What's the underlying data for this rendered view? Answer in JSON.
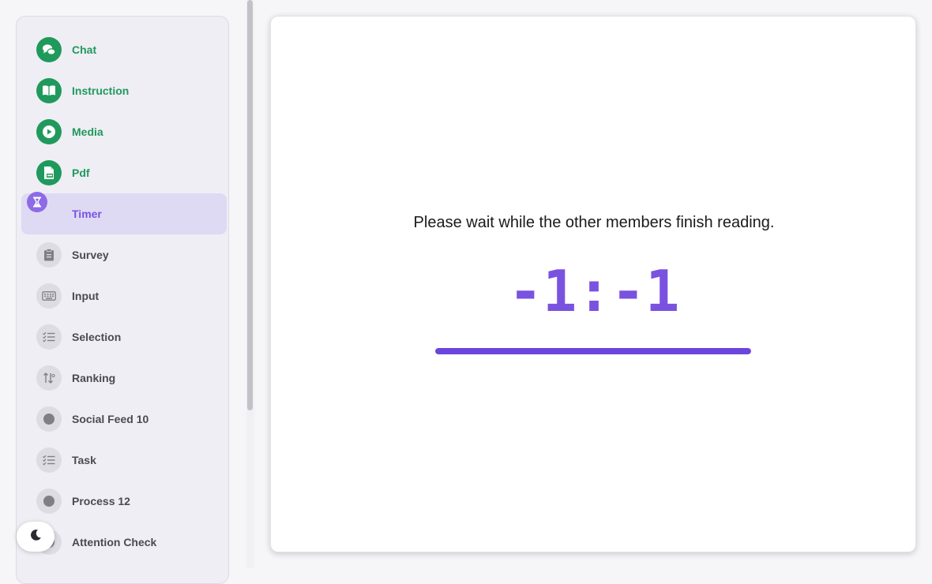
{
  "sidebar": {
    "items": [
      {
        "label": "Chat",
        "icon": "chat-bubbles-icon",
        "state": "done"
      },
      {
        "label": "Instruction",
        "icon": "book-open-icon",
        "state": "done"
      },
      {
        "label": "Media",
        "icon": "play-icon",
        "state": "done"
      },
      {
        "label": "Pdf",
        "icon": "pdf-file-icon",
        "state": "done"
      },
      {
        "label": "Timer",
        "icon": "hourglass-icon",
        "state": "active"
      },
      {
        "label": "Survey",
        "icon": "clipboard-icon",
        "state": "pending"
      },
      {
        "label": "Input",
        "icon": "keyboard-icon",
        "state": "pending"
      },
      {
        "label": "Selection",
        "icon": "checklist-icon",
        "state": "pending"
      },
      {
        "label": "Ranking",
        "icon": "sort-arrows-icon",
        "state": "pending"
      },
      {
        "label": "Social Feed 10",
        "icon": "dot-icon",
        "state": "pending"
      },
      {
        "label": "Task",
        "icon": "checklist-icon",
        "state": "pending"
      },
      {
        "label": "Process 12",
        "icon": "dot-icon",
        "state": "pending"
      },
      {
        "label": "Attention Check",
        "icon": "dot-icon",
        "state": "pending"
      }
    ]
  },
  "main": {
    "message": "Please wait while the other members finish reading.",
    "timer": "-1:-1",
    "progress": 1.0
  },
  "theme_toggle": {
    "icon": "moon-icon"
  },
  "colors": {
    "done": "#1f9a5c",
    "active": "#7a52e0",
    "active_bg": "#dedaf4",
    "pending_icon_bg": "#dcdce2",
    "progress": "#6c45dc"
  }
}
